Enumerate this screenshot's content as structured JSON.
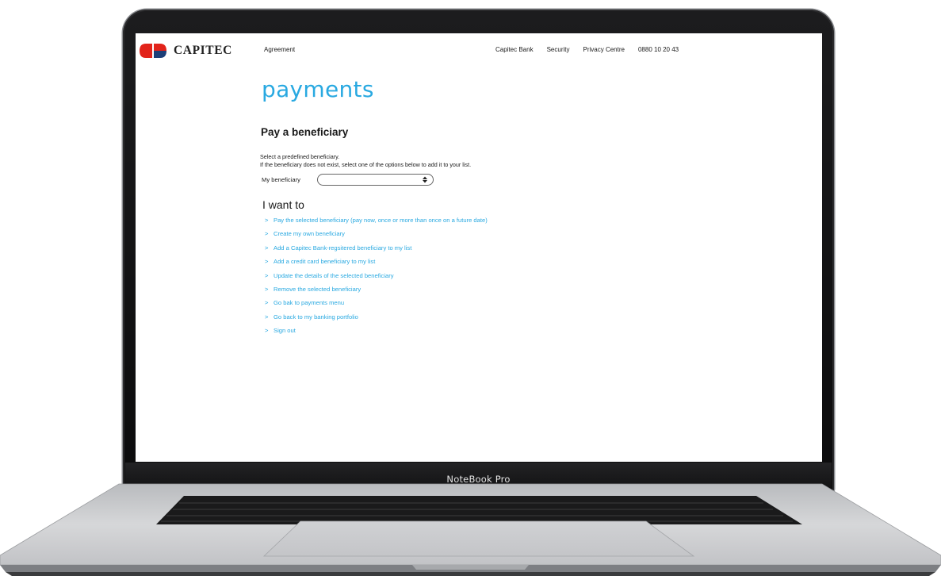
{
  "device": {
    "label": "NoteBook Pro"
  },
  "brand": {
    "name": "CAPITEC",
    "colors": {
      "red": "#e2231a",
      "navy": "#1d3f78"
    }
  },
  "nav": {
    "left": "Agreement",
    "right": [
      "Capitec Bank",
      "Security",
      "Privacy Centre",
      "0880 10 20 43"
    ]
  },
  "page": {
    "title": "payments",
    "section_title": "Pay a beneficiary",
    "intro_line1": "Select a predefined beneficiary.",
    "intro_line2": "If the beneficiary does not exist, select one of the options below to add it to your list.",
    "beneficiary_label": "My beneficiary",
    "beneficiary_value": "",
    "want_title": "I want to",
    "actions": [
      {
        "label": "Pay the selected beneficiary (pay now, once or more than once on a future date)"
      },
      {
        "label": "Create my own beneficiary"
      },
      {
        "label": "Add a Capitec Bank-regsitered beneficiary to my list"
      },
      {
        "label": "Add a credit card beneficiary to my list"
      },
      {
        "label": "Update the details of the selected beneficiary"
      },
      {
        "label": "Remove the selected beneficiary"
      },
      {
        "label": "Go bak to payments menu"
      },
      {
        "label": "Go back to my banking portfolio"
      },
      {
        "label": "Sign out"
      }
    ],
    "action_prefix": ">",
    "link_color": "#29a9e1"
  }
}
